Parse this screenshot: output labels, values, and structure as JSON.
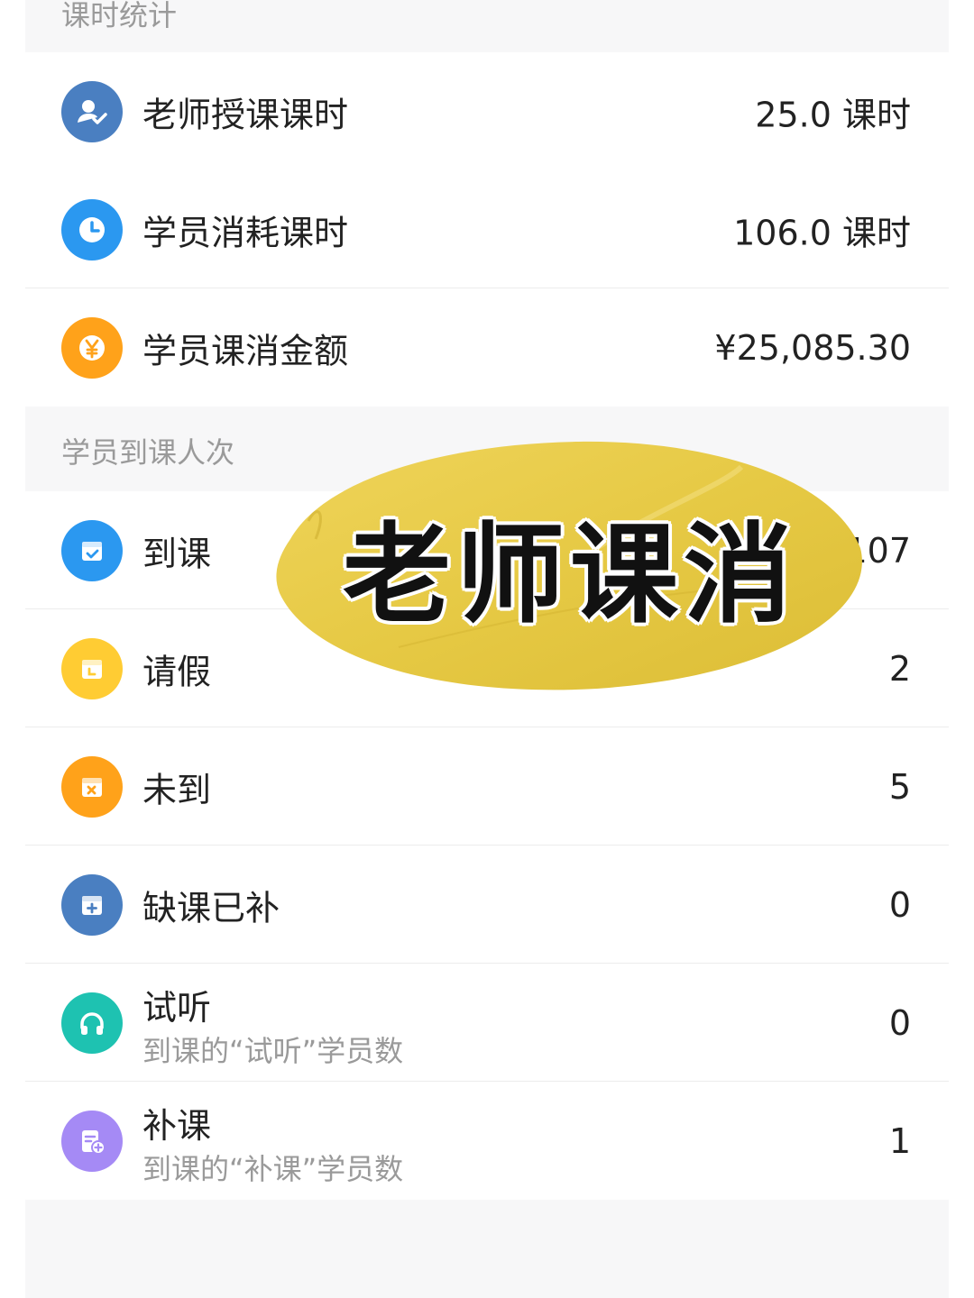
{
  "sections": {
    "hours_title": "课时统计",
    "attendance_title": "学员到课人次"
  },
  "hours": [
    {
      "label": "老师授课课时",
      "value": "25.0 课时",
      "icon": "teacher-icon",
      "color": "#4a7fc1"
    },
    {
      "label": "学员消耗课时",
      "value": "106.0 课时",
      "icon": "clock-icon",
      "color": "#2b98f0"
    },
    {
      "label": "学员课消金额",
      "value": "¥25,085.30",
      "icon": "yuan-icon",
      "color": "#ffa21a"
    }
  ],
  "attendance": [
    {
      "label": "到课",
      "value": "107",
      "icon": "calendar-check-icon",
      "color": "#2b98f0"
    },
    {
      "label": "请假",
      "value": "2",
      "icon": "calendar-leave-icon",
      "color": "#ffcc33"
    },
    {
      "label": "未到",
      "value": "5",
      "icon": "calendar-x-icon",
      "color": "#ffa21a"
    },
    {
      "label": "缺课已补",
      "value": "0",
      "icon": "calendar-plus-icon",
      "color": "#4a7fc1"
    },
    {
      "label": "试听",
      "sub": "到课的“试听”学员数",
      "value": "0",
      "icon": "headphones-icon",
      "color": "#1ec2b1"
    },
    {
      "label": "补课",
      "sub": "到课的“补课”学员数",
      "value": "1",
      "icon": "makeup-class-icon",
      "color": "#a58af5"
    }
  ],
  "sticker": {
    "text": "老师课消",
    "color": "#e9cc4a"
  }
}
